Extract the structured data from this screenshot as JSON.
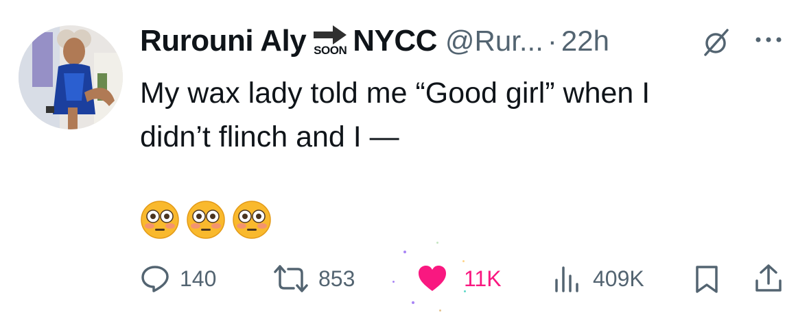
{
  "tweet": {
    "author": {
      "display_name": "Rurouni Aly",
      "badge_text": "SOON",
      "display_name_suffix": "NYCC",
      "handle": "@Rur...",
      "separator": "·",
      "time": "22h",
      "avatar_icon": "profile-photo"
    },
    "text_line1": "My wax lady told me “Good girl” when I",
    "text_line2": "didn’t flinch and I —",
    "emojis": [
      "flushed-face",
      "flushed-face",
      "flushed-face"
    ],
    "actions": {
      "replies": "140",
      "reposts": "853",
      "likes": "11K",
      "views": "409K"
    },
    "colors": {
      "text": "#0f1419",
      "secondary": "#536471",
      "like": "#f91880"
    }
  }
}
